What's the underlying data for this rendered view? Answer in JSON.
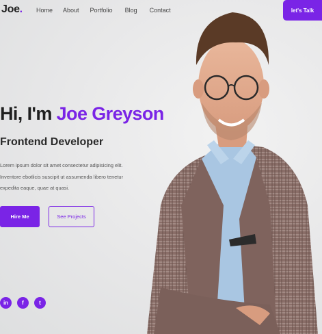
{
  "header": {
    "logo_text": "Joe",
    "logo_dot": ".",
    "nav": [
      "Home",
      "About",
      "Portfolio",
      "Blog",
      "Contact"
    ],
    "cta_label": "let's Talk"
  },
  "hero": {
    "greeting": "Hi, I'm ",
    "name": "Joe Greyson",
    "role": "Frontend Developer",
    "description": "Lorem ipsum dolor sit amet consectetur adipisicing elit. Inventore ebotlicis suscipit ut assumenda libero tenetur expedita eaque, quae at quasi.",
    "primary_button": "Hire Me",
    "secondary_button": "See Projects"
  },
  "social": {
    "linkedin_glyph": "in",
    "facebook_glyph": "f",
    "twitter_glyph": "t"
  },
  "colors": {
    "accent": "#7a24e6"
  }
}
